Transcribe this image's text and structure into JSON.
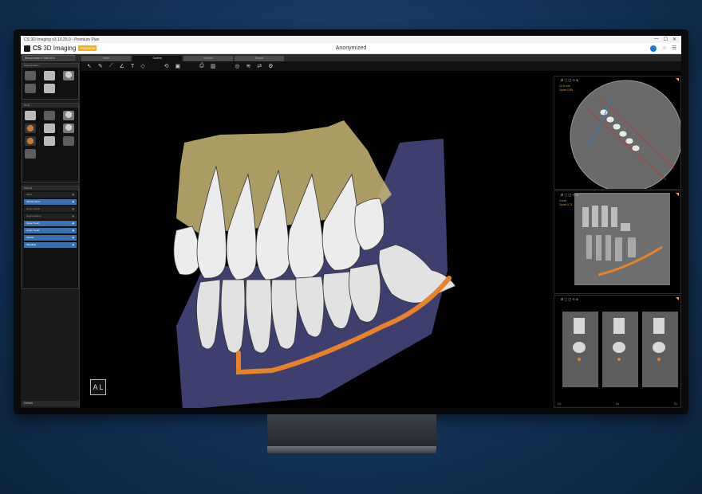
{
  "app": {
    "window_title": "CS 3D Imaging v3.10.25.0 - Premium Plan",
    "brand": "CS",
    "product": "3D Imaging",
    "badge": "PREMIUM",
    "patient_name": "Anonymized",
    "window_controls": [
      "—",
      "☐",
      "✕"
    ]
  },
  "header": {
    "patient_selector": "Anonymized 07/08/2019",
    "tabs": [
      {
        "label": "Main",
        "active": false
      },
      {
        "label": "Outline",
        "active": true
      },
      {
        "label": "Implant",
        "active": false
      },
      {
        "label": "Export",
        "active": false
      }
    ]
  },
  "left_panel": {
    "sections": [
      {
        "title": "Segmentation"
      },
      {
        "title": "Tools"
      },
      {
        "title": "Objects"
      }
    ],
    "objects": [
      {
        "label": "Skull",
        "style": "head"
      },
      {
        "label": "Maxilla Mesh",
        "style": "sel"
      },
      {
        "label": "Nerve Canal",
        "style": "head"
      },
      {
        "label": "Segmentation",
        "style": "head"
      },
      {
        "label": "Upper Teeth",
        "style": "sel"
      },
      {
        "label": "Lower Teeth",
        "style": "sel"
      },
      {
        "label": "Maxilla",
        "style": "sel"
      },
      {
        "label": "Mandible",
        "style": "sel"
      }
    ],
    "footer_label": "Default"
  },
  "toolbar": {
    "icons": [
      "cursor-icon",
      "pen-icon",
      "ruler-icon",
      "angle-icon",
      "text-icon",
      "rotate-icon",
      "camera-icon",
      "print-icon",
      "sun-icon",
      "layers-icon",
      "share-icon"
    ]
  },
  "viewport": {
    "orientation_labels": [
      "A",
      "L"
    ]
  },
  "right_panels": {
    "axial": {
      "info": [
        "22.0 mm",
        "Zoom 0.89"
      ]
    },
    "panoramic": {
      "info": [
        "Curve",
        "Zoom 0.71"
      ]
    },
    "cross_section": {
      "bottom": [
        "Cx",
        "Cx",
        "Cx"
      ]
    }
  },
  "colors": {
    "accent_orange": "#e8822a",
    "maxilla": "#c9b774",
    "mandible": "#4a4a82",
    "tooth": "#e9e9e9",
    "brand_badge": "#f2b01e"
  }
}
